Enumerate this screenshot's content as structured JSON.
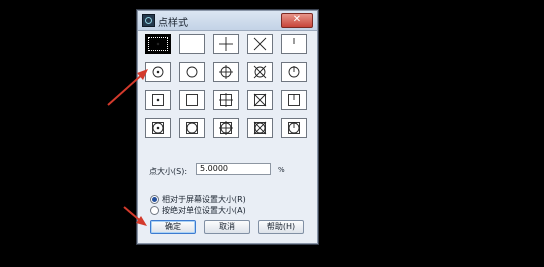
{
  "dialog": {
    "title": "点样式",
    "close_label": "✕",
    "point_styles": [
      [
        "dot-selected",
        "none",
        "plus",
        "x",
        "tick"
      ],
      [
        "circle-dot",
        "circle",
        "circle-plus",
        "circle-x",
        "circle-tick"
      ],
      [
        "square-dot",
        "square",
        "square-plus",
        "square-x",
        "square-tick"
      ],
      [
        "sqcircle-dot",
        "sqcircle",
        "sqcircle-plus",
        "sqcircle-x",
        "sqcircle-tick"
      ]
    ],
    "size_label": "点大小(S):",
    "size_value": "5.0000",
    "size_unit": "%",
    "options": [
      {
        "label": "相对于屏幕设置大小(R)",
        "checked": true
      },
      {
        "label": "按绝对单位设置大小(A)",
        "checked": false
      }
    ],
    "buttons": {
      "ok": "确定",
      "cancel": "取消",
      "help": "帮助(H)"
    }
  },
  "colors": {
    "arrow": "#d33a2c"
  }
}
